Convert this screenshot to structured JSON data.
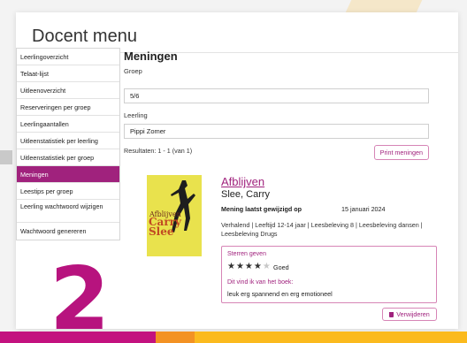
{
  "page": {
    "title": "Docent menu"
  },
  "sidebar": {
    "items": [
      {
        "label": "Leerlingoverzicht",
        "active": false
      },
      {
        "label": "Telaat-lijst",
        "active": false
      },
      {
        "label": "Uitleenoverzicht",
        "active": false
      },
      {
        "label": "Reserveringen per groep",
        "active": false
      },
      {
        "label": "Leerlingaantallen",
        "active": false
      },
      {
        "label": "Uitleenstatistiek per leerling",
        "active": false
      },
      {
        "label": "Uitleenstatistiek per groep",
        "active": false
      },
      {
        "label": "Meningen",
        "active": true
      },
      {
        "label": "Leestips per groep",
        "active": false
      },
      {
        "label": "Leerling wachtwoord wijzigen",
        "active": false
      },
      {
        "label": "Wachtwoord genereren",
        "active": false
      }
    ]
  },
  "main": {
    "heading": "Meningen",
    "group_label": "Groep",
    "group_value": "5/6",
    "student_label": "Leerling",
    "student_value": "Pippi Zomer",
    "results_text": "Resultaten: 1 - 1 (van 1)",
    "print_button": "Print meningen"
  },
  "book": {
    "cover_title": "Afblijven",
    "cover_author": "Carry Slee",
    "title": "Afblijven",
    "author": "Slee, Carry",
    "modified_label": "Mening laatst gewijzigd op",
    "modified_date": "15 januari 2024",
    "tags": "Verhalend | Leeftijd 12-14 jaar | Leesbeleving 8 | Leesbeleving dansen | Leesbeleving Drugs"
  },
  "review": {
    "stars_label": "Sterren geven",
    "stars_filled": "★★★★",
    "stars_empty": "★",
    "rating": 4,
    "rating_max": 5,
    "rating_text": "Goed",
    "opinion_label": "Dit vind ik van het boek:",
    "opinion_text": "leuk erg spannend en erg emotioneel",
    "delete_button": "Verwijderen"
  },
  "decor": {
    "big_number": "2",
    "colors": {
      "accent": "#a0227d",
      "band_magenta": "#c3127f",
      "band_orange": "#f39223",
      "band_yellow": "#fbba1e"
    }
  }
}
